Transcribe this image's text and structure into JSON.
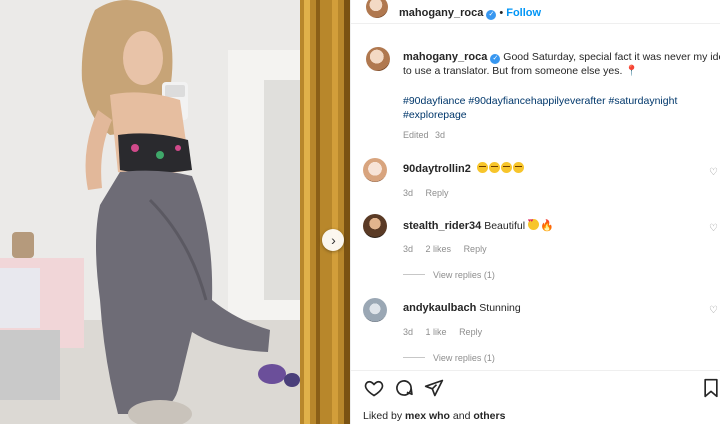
{
  "post": {
    "username": "mahogany_roca",
    "follow_label": "Follow",
    "caption_text": "Good Saturday, special fact it was never my idea to use a translator. But from someone else yes.",
    "caption_line1": "Good Saturday, special fact it was never my idea",
    "caption_line2": "to use a translator. But from someone else yes.",
    "hashtags_line1": "#90dayfiance #90dayfiancehappilyeverafter #saturdaynight",
    "hashtags_line2": "#explorepage",
    "edited": "Edited",
    "edited_time": "3d"
  },
  "comments": [
    {
      "username": "90daytrollin2",
      "text": "",
      "emoji_count": 4,
      "time": "3d",
      "likes": "",
      "reply": "Reply",
      "view_replies": ""
    },
    {
      "username": "stealth_rider34",
      "text": "Beautiful",
      "time": "3d",
      "likes": "2 likes",
      "reply": "Reply",
      "view_replies": "View replies (1)"
    },
    {
      "username": "andykaulbach",
      "text": "Stunning",
      "time": "3d",
      "likes": "1 like",
      "reply": "Reply",
      "view_replies": "View replies (1)"
    }
  ],
  "footer": {
    "liked_by_prefix": "Liked by",
    "liked_by_user": "mex",
    "liked_by_middle": "who",
    "liked_by_and": "and",
    "liked_by_others": "others"
  },
  "icons": {
    "verified": "verified-badge-icon",
    "next": "chevron-right-icon",
    "like": "heart-outline-icon",
    "comment": "speech-bubble-icon",
    "share": "paper-plane-icon",
    "save": "bookmark-icon"
  },
  "colors": {
    "accent": "#0095f6",
    "hashtag": "#00376b",
    "muted": "#8e8e8e",
    "verified": "#3897f0"
  }
}
